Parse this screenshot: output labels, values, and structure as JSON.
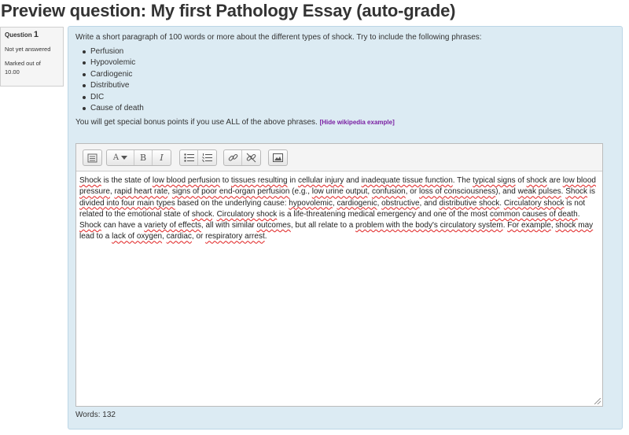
{
  "page": {
    "title": "Preview question: My first Pathology Essay (auto-grade)"
  },
  "info": {
    "question_label": "Question",
    "question_number": "1",
    "state": "Not yet answered",
    "marked_out_of_label": "Marked out of",
    "max_mark": "10.00"
  },
  "question": {
    "intro": "Write a short paragraph of 100 words or more about the different types of shock. Try to include the following phrases:",
    "phrases": [
      "Perfusion",
      "Hypovolemic",
      "Cardiogenic",
      "Distributive",
      "DIC",
      "Cause of death"
    ],
    "bonus_text": "You will get special bonus points if you use ALL of the above phrases.",
    "wiki_link": "[Hide wikipedia example]"
  },
  "editor": {
    "toolbar": [
      {
        "name": "toolbar-toggle-icon"
      },
      {
        "name": "font-style-icon",
        "glyph": "A"
      },
      {
        "name": "bold-icon",
        "glyph": "B"
      },
      {
        "name": "italic-icon",
        "glyph": "I"
      },
      {
        "name": "bullet-list-icon"
      },
      {
        "name": "numbered-list-icon"
      },
      {
        "name": "link-icon"
      },
      {
        "name": "unlink-icon"
      },
      {
        "name": "image-icon"
      }
    ],
    "answer_segments": [
      {
        "t": "Shock",
        "s": true
      },
      {
        "t": " is the state of "
      },
      {
        "t": "low blood perfusion",
        "s": true
      },
      {
        "t": " to "
      },
      {
        "t": "tissues resulting",
        "s": true
      },
      {
        "t": " in "
      },
      {
        "t": "cellular injury",
        "s": true
      },
      {
        "t": " and "
      },
      {
        "t": "inadequate tissue function",
        "s": true
      },
      {
        "t": ". The "
      },
      {
        "t": "typical signs",
        "s": true
      },
      {
        "t": " of "
      },
      {
        "t": "shock",
        "s": true
      },
      {
        "t": " are "
      },
      {
        "t": "low blood pressure",
        "s": true
      },
      {
        "t": ", "
      },
      {
        "t": "rapid heart rate",
        "s": true
      },
      {
        "t": ", "
      },
      {
        "t": "signs of poor end-organ perfusion",
        "s": true
      },
      {
        "t": " (e.g., "
      },
      {
        "t": "low urine output",
        "s": true
      },
      {
        "t": ", "
      },
      {
        "t": "confusion",
        "s": true
      },
      {
        "t": ", or "
      },
      {
        "t": "loss of consciousness",
        "s": true
      },
      {
        "t": "), and "
      },
      {
        "t": "weak pulses",
        "s": true
      },
      {
        "t": ". "
      },
      {
        "t": "Shock",
        "s": true
      },
      {
        "t": " is "
      },
      {
        "t": "divided into four main types",
        "s": true
      },
      {
        "t": " based on the underlying cause: "
      },
      {
        "t": "hypovolemic",
        "s": true
      },
      {
        "t": ", "
      },
      {
        "t": "cardiogenic",
        "s": true
      },
      {
        "t": ", "
      },
      {
        "t": "obstructive",
        "s": true
      },
      {
        "t": ", and "
      },
      {
        "t": "distributive shock",
        "s": true
      },
      {
        "t": ". "
      },
      {
        "t": "Circulatory shock",
        "s": true
      },
      {
        "t": " is not related to the emotional state of "
      },
      {
        "t": "shock",
        "s": true
      },
      {
        "t": ". "
      },
      {
        "t": "Circulatory shock",
        "s": true
      },
      {
        "t": " is a life-threatening medical emergency and one of the most "
      },
      {
        "t": "common causes of death",
        "s": true
      },
      {
        "t": ". "
      },
      {
        "t": "Shock",
        "s": true
      },
      {
        "t": " can have a "
      },
      {
        "t": "variety of effects",
        "s": true
      },
      {
        "t": ", all with similar "
      },
      {
        "t": "outcomes",
        "s": true
      },
      {
        "t": ", but all relate to a "
      },
      {
        "t": "problem with the body's circulatory system",
        "s": true
      },
      {
        "t": ". "
      },
      {
        "t": "For example",
        "s": true
      },
      {
        "t": ", "
      },
      {
        "t": "shock may",
        "s": true
      },
      {
        "t": " lead to a "
      },
      {
        "t": "lack of oxygen",
        "s": true
      },
      {
        "t": ", "
      },
      {
        "t": "cardiac",
        "s": true
      },
      {
        "t": ", or "
      },
      {
        "t": "respiratory arrest",
        "s": true
      },
      {
        "t": "."
      }
    ]
  },
  "word_count": {
    "label": "Words:",
    "value": "132"
  }
}
